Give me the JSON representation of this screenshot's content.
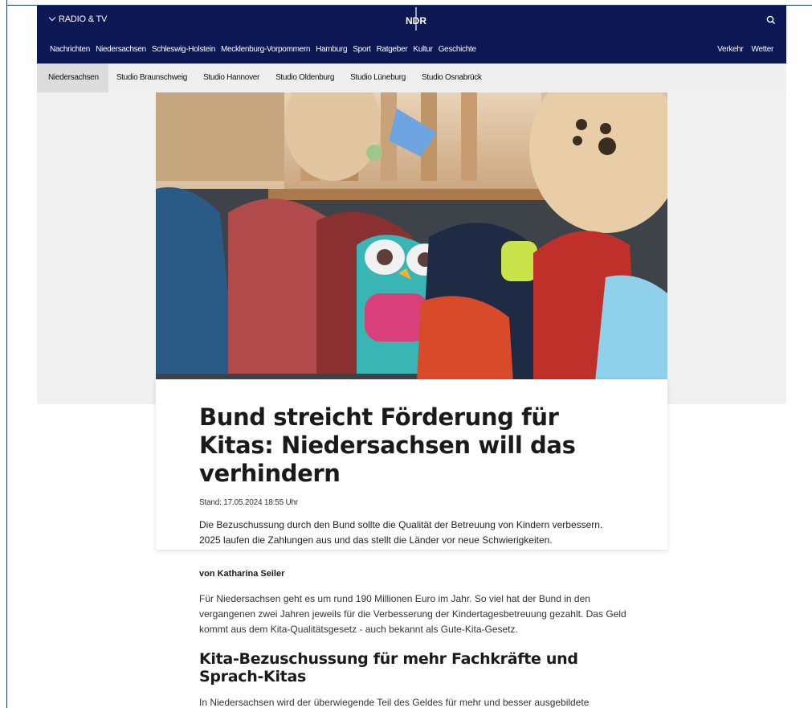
{
  "topbar": {
    "radio_tv_label": "RADIO & TV",
    "logo_text": "NDR"
  },
  "mainnav": {
    "left": [
      "Nachrichten",
      "Niedersachsen",
      "Schleswig-Holstein",
      "Mecklenburg-Vorpommern",
      "Hamburg",
      "Sport",
      "Ratgeber",
      "Kultur",
      "Geschichte"
    ],
    "right": [
      "Verkehr",
      "Wetter"
    ]
  },
  "subnav": {
    "items": [
      "Niedersachsen",
      "Studio Braunschweig",
      "Studio Hannover",
      "Studio Oldenburg",
      "Studio Lüneburg",
      "Studio Osnabrück"
    ],
    "active": "Niedersachsen"
  },
  "article": {
    "title": "Bund streicht Förderung für Kitas: Niedersachsen will das verhindern",
    "stand": "Stand: 17.05.2024 18:55 Uhr",
    "lead": "Die Bezuschussung durch den Bund sollte die Qualität der Betreuung von Kindern verbessern. 2025 laufen die Zahlungen aus und das stellt die Länder vor neue Schwierigkeiten.",
    "byline": "von Katharina Seiler",
    "paragraph1": "Für Niedersachsen geht es um rund 190 Millionen Euro im Jahr. So viel hat der Bund in den vergangenen zwei Jahren jeweils für die Verbesserung der Kindertagesbetreuung gezahlt. Das Geld kommt aus dem Kita-Qualitätsgesetz - auch bekannt als Gute-Kita-Gesetz.",
    "subheading": "Kita-Bezuschussung für mehr Fachkräfte und Sprach-Kitas",
    "paragraph2": "In Niedersachsen wird der überwiegende Teil des Geldes für mehr und besser ausgebildete Fachkräfte und für die Sprach-Kitas eingesetzt. Erfolgreich, wie die niedersächsische"
  },
  "colors": {
    "brand_navy": "#0c1754",
    "subnav_bg": "#efefef",
    "hero_bg": "#f0f0f0"
  }
}
